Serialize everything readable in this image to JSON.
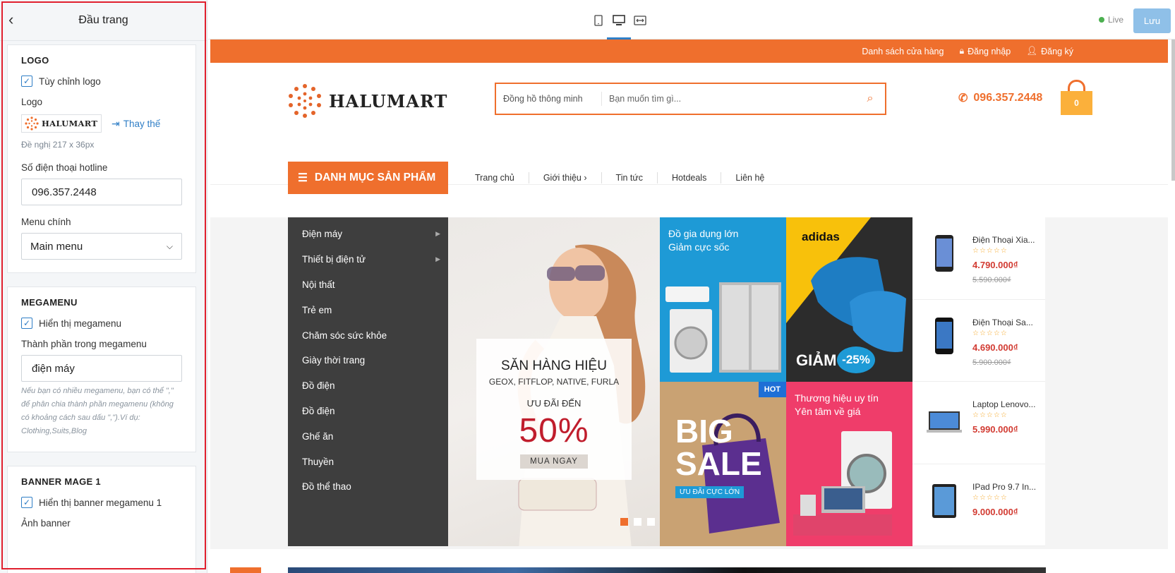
{
  "sidebar": {
    "title": "Đầu trang",
    "logo_section": {
      "heading": "LOGO",
      "custom_logo_label": "Tùy chỉnh logo",
      "logo_label": "Logo",
      "logo_text": "HALUMART",
      "replace_label": "Thay thế",
      "size_hint": "Đề nghị 217 x 36px",
      "hotline_label": "Số điện thoại hotline",
      "hotline_value": "096.357.2448",
      "main_menu_label": "Menu chính",
      "main_menu_value": "Main menu"
    },
    "megamenu_section": {
      "heading": "MEGAMENU",
      "show_label": "Hiển thị megamenu",
      "components_label": "Thành phần trong megamenu",
      "components_value": "điện máy",
      "help": "Nếu bạn có nhiều megamenu, bạn có thể \",\" để phân chia thành phần megamenu (không có khoảng cách sau dấu \",\").Ví dụ: Clothing,Suits,Blog"
    },
    "banner_section": {
      "heading": "BANNER MAGE 1",
      "show_label": "Hiển thị banner megamenu 1",
      "image_label": "Ảnh banner"
    }
  },
  "topbar": {
    "live_label": "Live",
    "save_label": "Lưu"
  },
  "store": {
    "util_links": [
      "Danh sách cửa hàng",
      "Đăng nhập",
      "Đăng ký"
    ],
    "brand": "HALUMART",
    "search_category": "Đồng hồ thông minh",
    "search_placeholder": "Bạn muốn tìm gì...",
    "hotline": "096.357.2448",
    "cart_count": "0",
    "category_button": "DANH MỤC SẢN PHẨM",
    "menu": [
      "Trang chủ",
      "Giới thiệu ›",
      "Tin tức",
      "Hotdeals",
      "Liên hệ"
    ],
    "categories": [
      {
        "label": "Điện máy",
        "has_sub": true
      },
      {
        "label": "Thiết bị điện tử",
        "has_sub": true
      },
      {
        "label": "Nội thất",
        "has_sub": false
      },
      {
        "label": "Trẻ em",
        "has_sub": false
      },
      {
        "label": "Chăm sóc sức khỏe",
        "has_sub": false
      },
      {
        "label": "Giày thời trang",
        "has_sub": false
      },
      {
        "label": "Đồ điện",
        "has_sub": false
      },
      {
        "label": "Đồ điện",
        "has_sub": false
      },
      {
        "label": "Ghế ăn",
        "has_sub": false
      },
      {
        "label": "Thuyền",
        "has_sub": false
      },
      {
        "label": "Đồ thể thao",
        "has_sub": false
      }
    ],
    "slide": {
      "line1": "SĂN HÀNG HIỆU",
      "line2": "GEOX, FITFLOP, NATIVE, FURLA",
      "line3": "ƯU ĐÃI ĐẾN",
      "line4": "50%",
      "cta": "MUA NGAY"
    },
    "tiles": {
      "t1": "Đồ gia dụng lớn\nGiảm cực sốc",
      "t2_brand": "adidas",
      "t2_sale": "GIẢM",
      "t2_pct": "-25%",
      "t3_hot": "HOT",
      "t3_big": "BIG",
      "t3_sale": "SALE",
      "t3_sub": "ƯU ĐÃI CỰC LỚN",
      "t4": "Thương hiệu uy tín\nYên tâm về giá"
    },
    "products": [
      {
        "name": "Điện Thoại Xia...",
        "price": "4.790.000₫",
        "old": "5.590.000₫",
        "stars": "☆☆☆☆☆"
      },
      {
        "name": "Điện Thoại Sa...",
        "price": "4.690.000₫",
        "old": "5.900.000₫",
        "stars": "☆☆☆☆☆"
      },
      {
        "name": "Laptop Lenovo...",
        "price": "5.990.000₫",
        "old": "",
        "stars": "☆☆☆☆☆"
      },
      {
        "name": "IPad Pro 9.7 In...",
        "price": "9.000.000₫",
        "old": "",
        "stars": "☆☆☆☆☆"
      }
    ]
  },
  "colors": {
    "accent": "#ef6f2d",
    "link": "#2f7ec6",
    "highlight_border": "#e0202e"
  }
}
